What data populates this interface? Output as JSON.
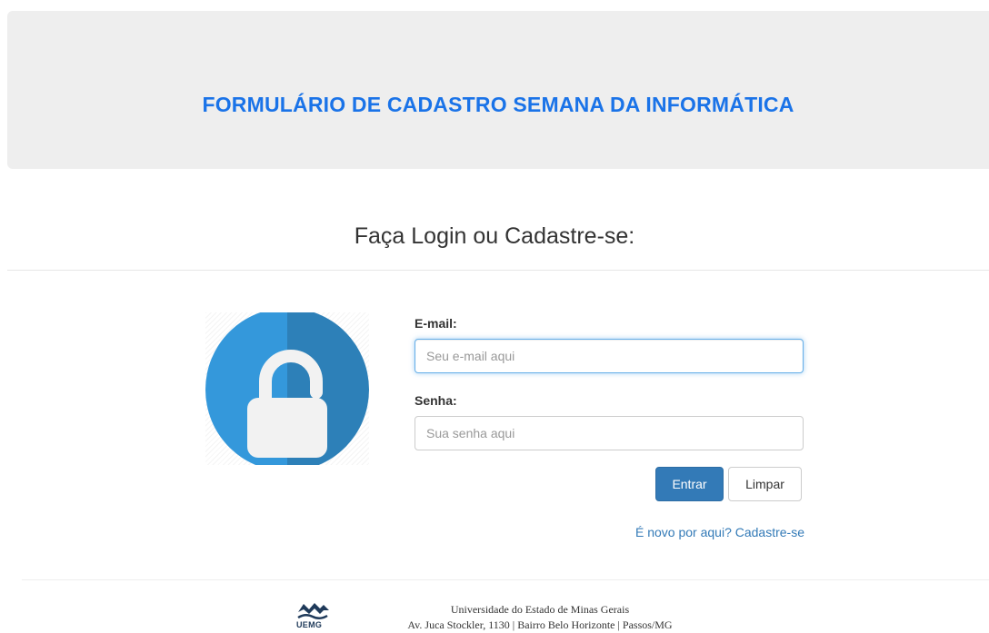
{
  "header": {
    "title": "FORMULÁRIO DE CADASTRO SEMANA DA INFORMÁTICA"
  },
  "subtitle": "Faça Login ou Cadastre-se:",
  "login_form": {
    "email_label": "E-mail:",
    "email_placeholder": "Seu e-mail aqui",
    "email_value": "",
    "password_label": "Senha:",
    "password_placeholder": "Sua senha aqui",
    "password_value": "",
    "submit_label": "Entrar",
    "reset_label": "Limpar",
    "register_link": "É novo por aqui? Cadastre-se"
  },
  "icons": {
    "lock": "unlocked-padlock-icon",
    "logo": "uemg-logo"
  },
  "footer": {
    "logo_text": "UEMG",
    "line1": "Universidade do Estado de Minas Gerais",
    "line2": "Av. Juca Stockler, 1130 | Bairro Belo Horizonte | Passos/MG"
  },
  "colors": {
    "title": "#1a73e8",
    "primary_button": "#337ab7",
    "link": "#337ab7",
    "lock_circle_light": "#3498db",
    "lock_circle_dark": "#2d80b8",
    "header_bg": "#eeeeee"
  }
}
